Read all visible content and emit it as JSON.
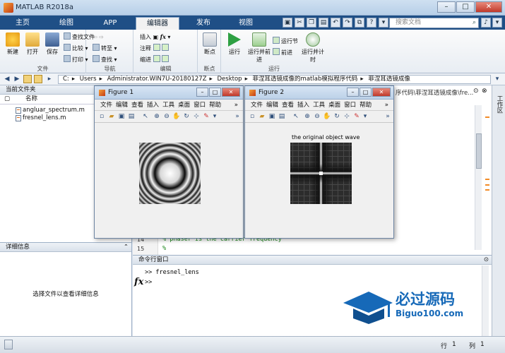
{
  "app": {
    "title": "MATLAB R2018a"
  },
  "tabs": [
    "主页",
    "绘图",
    "APP",
    "编辑器",
    "发布",
    "视图"
  ],
  "active_tab": "编辑器",
  "search": {
    "placeholder": "搜索文档"
  },
  "ribbon": {
    "file": {
      "new": "新建",
      "open": "打开",
      "save": "保存",
      "find_files": "查找文件",
      "compare": "比较",
      "print": "打印",
      "label": "文件"
    },
    "navigate": {
      "goto": "转至",
      "find": "查找",
      "label": "导航"
    },
    "edit": {
      "insert": "插入",
      "comment": "注释",
      "indent": "缩进",
      "fx": "fx",
      "label": "编辑"
    },
    "breakpoints": {
      "breakpoints": "断点",
      "label": "断点"
    },
    "run": {
      "run": "运行",
      "run_advance": "运行并前进",
      "run_section": "运行节",
      "advance": "前进",
      "run_time": "运行并计时",
      "label": "运行"
    }
  },
  "address": {
    "crumbs": [
      "C:",
      "Users",
      "Administrator.WIN7U-20180127Z",
      "Desktop",
      "菲涅耳透镜成像的matlab模拟程序代码",
      "菲涅耳透镜成像"
    ]
  },
  "left_panel": {
    "title": "当前文件夹",
    "column": "名称",
    "files": [
      "angluar_spectrum.m",
      "fresnel_lens.m"
    ],
    "details_title": "详细信息",
    "details_message": "选择文件以查看详细信息"
  },
  "editor": {
    "tab_path": "序代码\\菲涅耳透镜成像\\fre...",
    "lines": [
      {
        "num": "14",
        "code": "% phaser is the carrier frequency"
      },
      {
        "num": "15",
        "code": "%"
      }
    ]
  },
  "workspace_label": "工作区",
  "command_window": {
    "title": "命令行窗口",
    "history": ">> fresnel_lens",
    "prompt": ">>"
  },
  "status": {
    "row_label": "行",
    "row": "1",
    "col_label": "列",
    "col": "1"
  },
  "figure1": {
    "title": "Figure 1",
    "menu": [
      "文件",
      "编辑",
      "查看",
      "插入",
      "工具",
      "桌面",
      "窗口",
      "帮助"
    ]
  },
  "figure2": {
    "title": "Figure 2",
    "menu": [
      "文件",
      "编辑",
      "查看",
      "插入",
      "工具",
      "桌面",
      "窗口",
      "帮助"
    ],
    "plot_title": "the original object wave"
  },
  "watermark": {
    "text": "必过源码",
    "url": "Biguo100.com"
  },
  "colors": {
    "accent": "#1f4f86",
    "brand": "#1669b8"
  }
}
